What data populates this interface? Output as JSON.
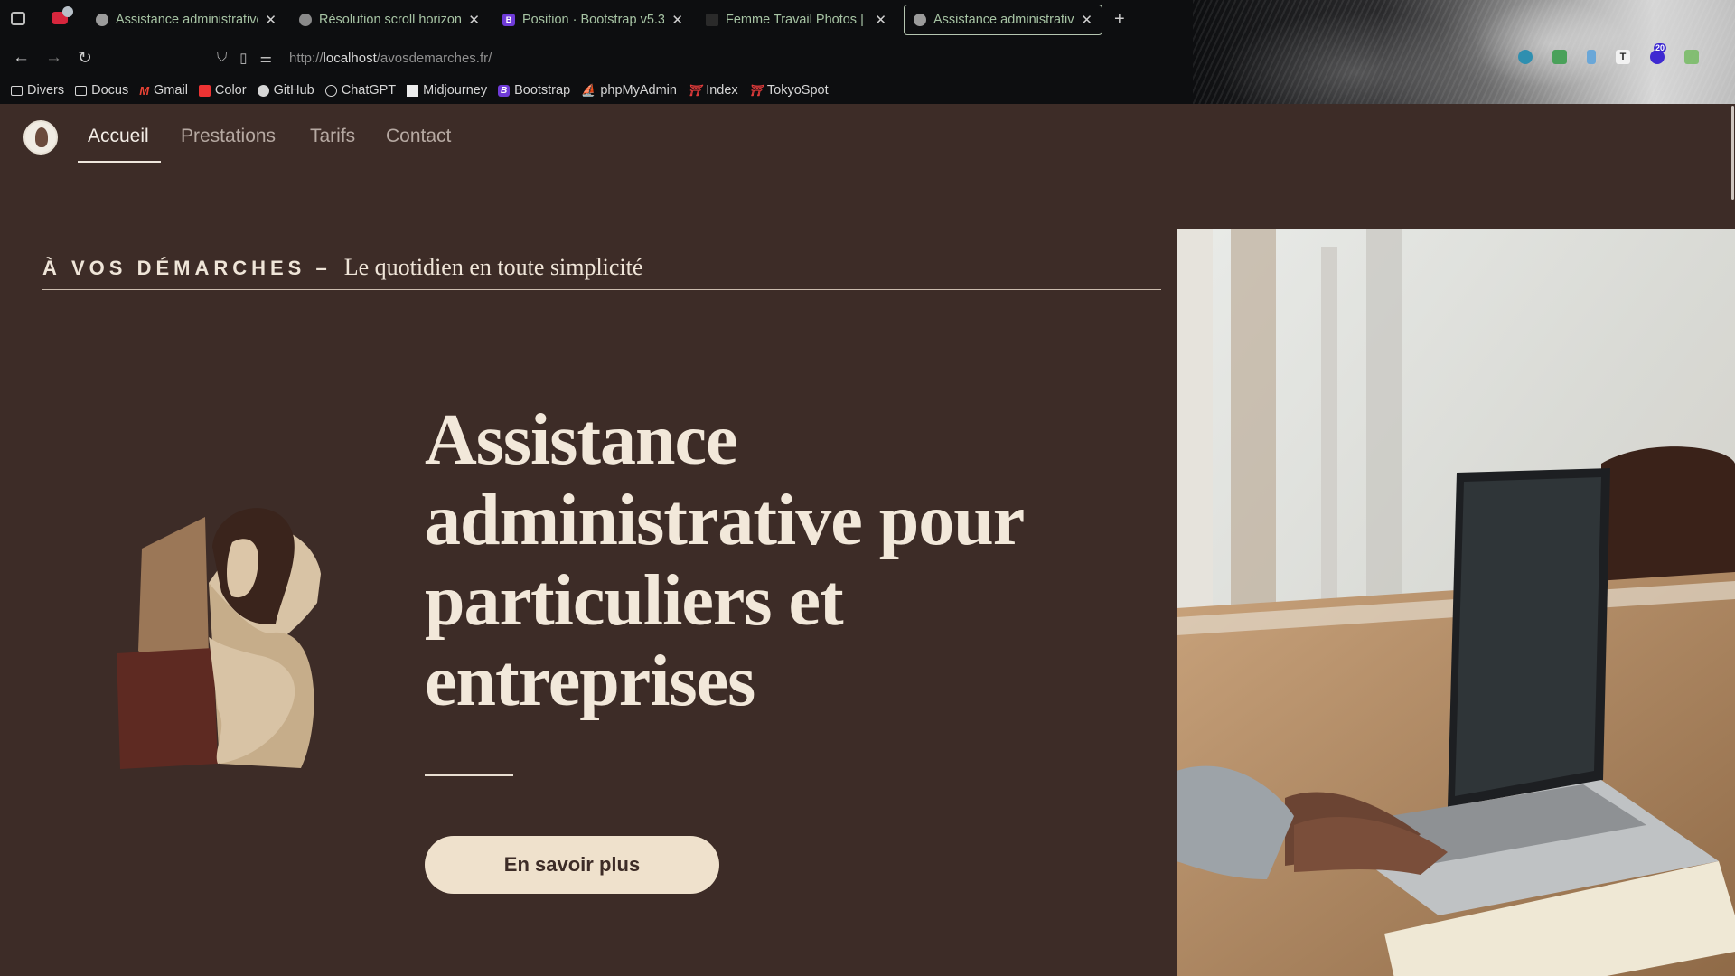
{
  "browser": {
    "tabs": [
      {
        "label": "Assistance administrative",
        "active": false
      },
      {
        "label": "Résolution scroll horizont",
        "active": false
      },
      {
        "label": "Position · Bootstrap v5.3",
        "active": false
      },
      {
        "label": "Femme Travail Photos | T",
        "active": false
      },
      {
        "label": "Assistance administrative",
        "active": true
      }
    ],
    "url_prefix": "http://",
    "url_host": "localhost",
    "url_path": "/avosdemarches.fr/",
    "extension_badge": "20",
    "bookmarks": [
      {
        "label": "Divers",
        "icon": "folder-icon"
      },
      {
        "label": "Docus",
        "icon": "folder-icon"
      },
      {
        "label": "Gmail",
        "icon": "gmail-icon"
      },
      {
        "label": "Color",
        "icon": "color-icon"
      },
      {
        "label": "GitHub",
        "icon": "github-icon"
      },
      {
        "label": "ChatGPT",
        "icon": "chatgpt-icon"
      },
      {
        "label": "Midjourney",
        "icon": "midjourney-icon"
      },
      {
        "label": "Bootstrap",
        "icon": "bootstrap-icon"
      },
      {
        "label": "phpMyAdmin",
        "icon": "phpmyadmin-icon"
      },
      {
        "label": "Index",
        "icon": "torii-icon"
      },
      {
        "label": "TokyoSpot",
        "icon": "torii-icon"
      }
    ]
  },
  "site": {
    "nav": {
      "links": [
        "Accueil",
        "Prestations",
        "Tarifs",
        "Contact"
      ],
      "active": "Accueil"
    },
    "tagline": {
      "brand": "À VOS DÉMARCHES –",
      "subtitle": "Le quotidien en toute simplicité"
    },
    "hero": {
      "line1": "Assistance",
      "line2": "administrative pour",
      "line3": "particuliers et",
      "line4": "entreprises",
      "cta": "En savoir plus"
    },
    "colors": {
      "background": "#3d2c27",
      "accent": "#efe1cc",
      "text": "#f2e8da"
    }
  }
}
